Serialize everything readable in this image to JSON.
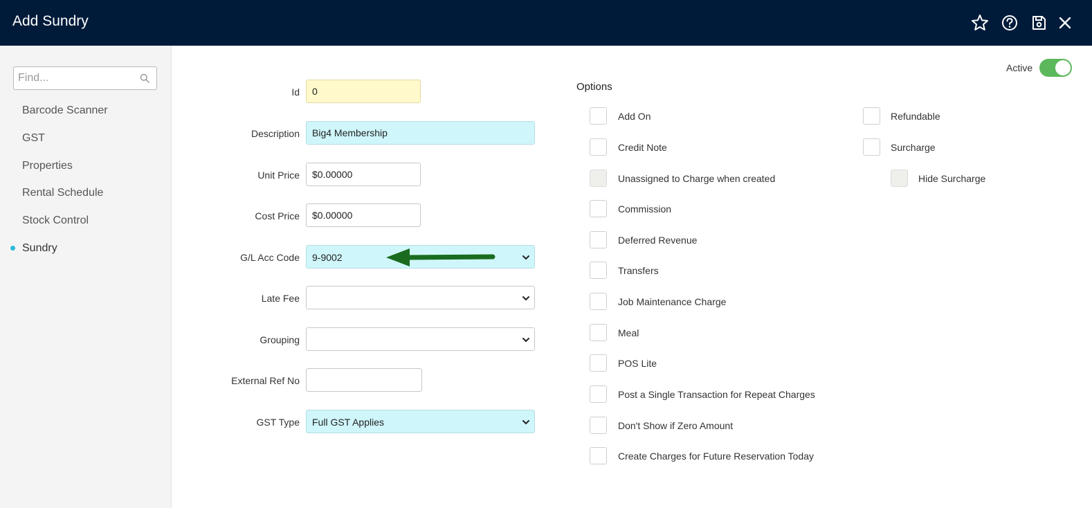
{
  "header": {
    "title": "Add Sundry",
    "icons": [
      "star-icon",
      "help-icon",
      "save-icon",
      "close-icon"
    ]
  },
  "sidebar": {
    "search_placeholder": "Find...",
    "items": [
      {
        "label": "Barcode Scanner"
      },
      {
        "label": "GST"
      },
      {
        "label": "Properties"
      },
      {
        "label": "Rental Schedule"
      },
      {
        "label": "Stock Control"
      },
      {
        "label": "Sundry",
        "active": true
      }
    ]
  },
  "form": {
    "id": {
      "label": "Id",
      "value": "0"
    },
    "description": {
      "label": "Description",
      "value": "Big4 Membership"
    },
    "unit_price": {
      "label": "Unit Price",
      "value": "$0.00000"
    },
    "cost_price": {
      "label": "Cost Price",
      "value": "$0.00000"
    },
    "gl_acc_code": {
      "label": "G/L Acc Code",
      "value": "9-9002"
    },
    "late_fee": {
      "label": "Late Fee",
      "value": ""
    },
    "grouping": {
      "label": "Grouping",
      "value": ""
    },
    "external_ref_no": {
      "label": "External Ref No",
      "value": ""
    },
    "gst_type": {
      "label": "GST Type",
      "value": "Full GST Applies"
    }
  },
  "active": {
    "label": "Active",
    "on": true
  },
  "options": {
    "title": "Options",
    "left": [
      {
        "label": "Add On",
        "checked": false
      },
      {
        "label": "Credit Note",
        "checked": false
      },
      {
        "label": "Unassigned to Charge when created",
        "checked": false,
        "disabled": true
      },
      {
        "label": "Commission",
        "checked": false
      },
      {
        "label": "Deferred Revenue",
        "checked": false
      },
      {
        "label": "Transfers",
        "checked": false
      },
      {
        "label": "Job Maintenance Charge",
        "checked": false
      },
      {
        "label": "Meal",
        "checked": false
      },
      {
        "label": "POS Lite",
        "checked": false
      },
      {
        "label": "Post a Single Transaction for Repeat Charges",
        "checked": false
      },
      {
        "label": "Don't Show if Zero Amount",
        "checked": false
      },
      {
        "label": "Create Charges for Future Reservation Today",
        "checked": false
      }
    ],
    "right": [
      {
        "label": "Refundable",
        "checked": false
      },
      {
        "label": "Surcharge",
        "checked": false
      },
      {
        "label": "Hide Surcharge",
        "checked": false,
        "disabled": true
      }
    ]
  },
  "colors": {
    "header_bg": "#001b3a",
    "accent": "#2bbbd8",
    "toggle_on": "#5cb85c",
    "arrow": "#1a6b1f"
  }
}
